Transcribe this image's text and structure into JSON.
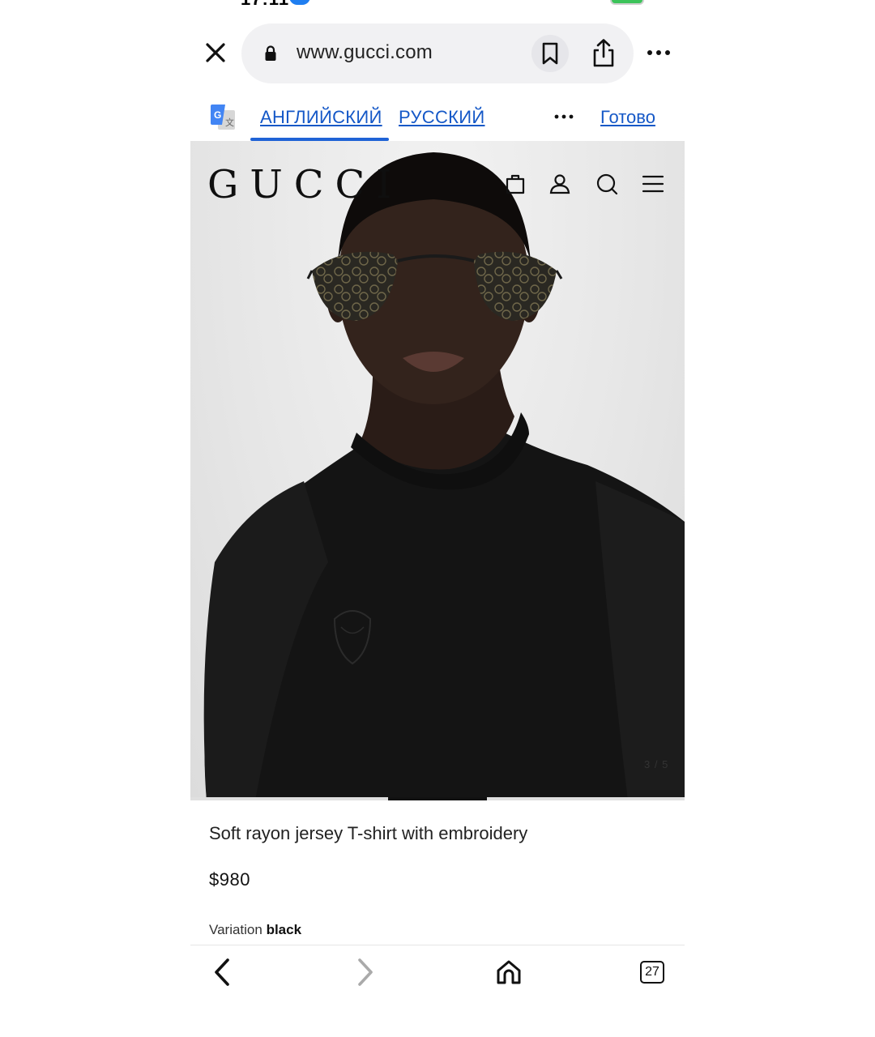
{
  "status_bar": {
    "time": "17:11"
  },
  "browser": {
    "url": "www.gucci.com",
    "icons": {
      "close": "close-icon",
      "lock": "lock-icon",
      "bookmark": "bookmark-icon",
      "share": "share-icon",
      "more": "more-icon"
    }
  },
  "translate_bar": {
    "source_lang": "АНГЛИЙСКИЙ",
    "target_lang": "РУССКИЙ",
    "done_label": "Готово",
    "icon": "google-translate-icon"
  },
  "site": {
    "logo": "GUCCI",
    "icons": [
      "shopping-bag-icon",
      "account-icon",
      "search-icon",
      "menu-icon"
    ]
  },
  "gallery": {
    "counter": "3 / 5",
    "current": 3,
    "total": 5
  },
  "product": {
    "name": "Soft rayon jersey T-shirt with embroidery",
    "price": "$980",
    "variation_label": "Variation",
    "variation_value": "black"
  },
  "toolbar": {
    "tabs_count": "27",
    "icons": [
      "back-icon",
      "forward-icon",
      "home-icon",
      "tabs-icon"
    ]
  },
  "colors": {
    "link_blue": "#1558c7",
    "urlbar_bg": "#f1f1f3",
    "shirt": "#161616"
  }
}
